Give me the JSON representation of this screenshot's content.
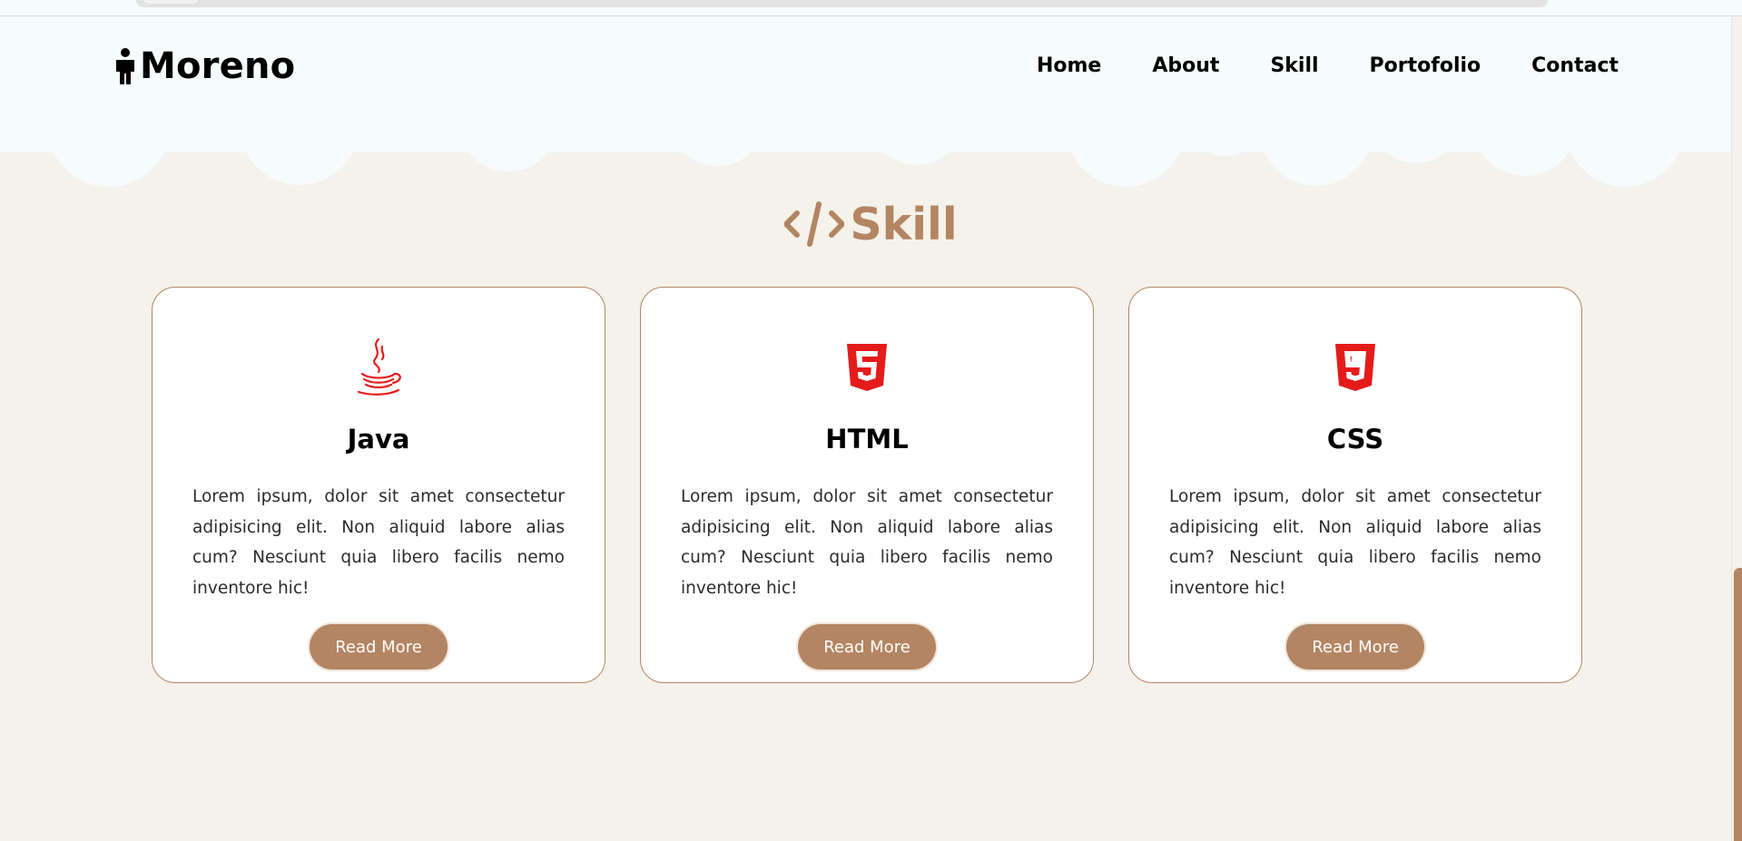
{
  "brand": {
    "name": "Moreno",
    "icon": "person-icon"
  },
  "nav": {
    "items": [
      {
        "label": "Home"
      },
      {
        "label": "About"
      },
      {
        "label": "Skill"
      },
      {
        "label": "Portofolio"
      },
      {
        "label": "Contact"
      }
    ]
  },
  "section": {
    "title": "Skill",
    "icon": "code-icon",
    "accent": "#b38562"
  },
  "cards": [
    {
      "title": "Java",
      "icon": "java-icon",
      "description": "Lorem ipsum, dolor sit amet consectetur adipisicing elit. Non aliquid labore alias cum? Nesciunt quia libero facilis nemo inventore hic!",
      "button": "Read More"
    },
    {
      "title": "HTML",
      "icon": "html5-icon",
      "description": "Lorem ipsum, dolor sit amet consectetur adipisicing elit. Non aliquid labore alias cum? Nesciunt quia libero facilis nemo inventore hic!",
      "button": "Read More"
    },
    {
      "title": "CSS",
      "icon": "css3-icon",
      "description": "Lorem ipsum, dolor sit amet consectetur adipisicing elit. Non aliquid labore alias cum? Nesciunt quia libero facilis nemo inventore hic!",
      "button": "Read More"
    }
  ],
  "colors": {
    "page_bg": "#f4f2ea",
    "header_bg": "#f6fbfc",
    "accent": "#b38562",
    "logo_red": "#e51b1b"
  }
}
